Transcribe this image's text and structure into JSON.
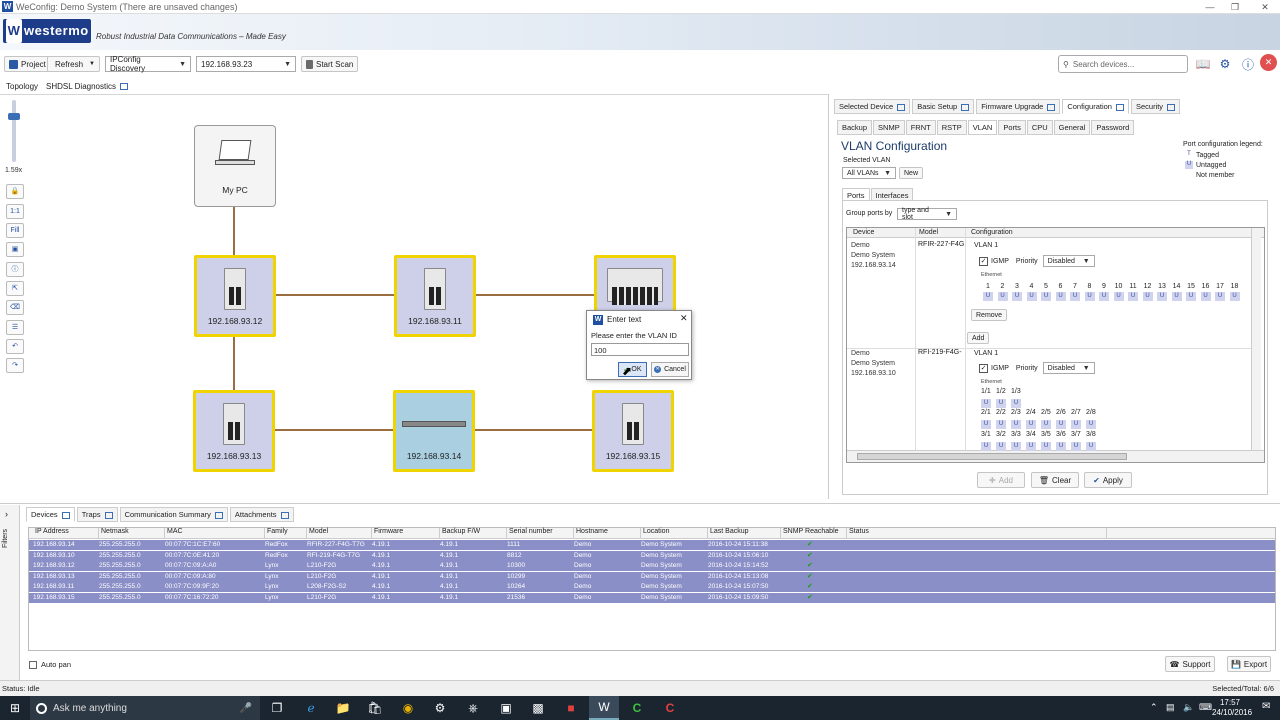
{
  "window": {
    "title": "WeConfig: Demo System (There are unsaved changes)",
    "app_icon": "W"
  },
  "banner": {
    "brand": "westermo",
    "brand_mark": "W",
    "tagline": "Robust Industrial Data Communications – Made Easy"
  },
  "toolbar": {
    "project_label": "Project",
    "refresh_label": "Refresh",
    "discovery_value": "IPConfig Discovery",
    "ip_value": "192.168.93.23",
    "start_scan_label": "Start Scan",
    "search_placeholder": "Search devices..."
  },
  "view_tabs": [
    "Topology",
    "SHDSL Diagnostics"
  ],
  "zoom_label": "1.59x",
  "left_tools": {
    "one_to_one": "1:1",
    "fill": "Fill"
  },
  "topology": {
    "pc_label": "My PC",
    "nodes": [
      {
        "ip": "192.168.93.12"
      },
      {
        "ip": "192.168.93.11"
      },
      {
        "ip": "192.168.93.13"
      },
      {
        "ip": "192.168.93.14"
      },
      {
        "ip": "192.168.93.15"
      }
    ]
  },
  "dialog": {
    "title": "Enter text",
    "prompt": "Please enter the VLAN ID",
    "value": "100",
    "ok": "OK",
    "cancel": "Cancel"
  },
  "right_panel": {
    "tabs": [
      "Selected Device",
      "Basic Setup",
      "Firmware Upgrade",
      "Configuration",
      "Security"
    ],
    "subtabs": [
      "Backup",
      "SNMP",
      "FRNT",
      "RSTP",
      "VLAN",
      "Ports",
      "CPU",
      "General",
      "Password"
    ],
    "heading": "VLAN Configuration",
    "selected_vlan_label": "Selected VLAN",
    "selected_vlan_value": "All VLANs",
    "new_button": "New",
    "legend_title": "Port configuration legend:",
    "legend": [
      {
        "mark": "T",
        "label": "Tagged"
      },
      {
        "mark": "U",
        "label": "Untagged"
      },
      {
        "mark": "",
        "label": "Not member"
      }
    ],
    "inner_tabs": [
      "Ports",
      "Interfaces"
    ],
    "group_label": "Group ports by",
    "group_value": "type and slot",
    "grid_headers": [
      "Device",
      "Model",
      "Configuration"
    ],
    "rows": [
      {
        "name": "Demo",
        "system": "Demo System",
        "ip": "192.168.93.14",
        "model": "RFIR-227-F4G",
        "vlan": "VLAN 1",
        "igmp": "IGMP",
        "priority_label": "Priority",
        "priority_value": "Disabled",
        "port_group": "Ethernet",
        "ports": [
          "1",
          "2",
          "3",
          "4",
          "5",
          "6",
          "7",
          "8",
          "9",
          "10",
          "11",
          "12",
          "13",
          "14",
          "15",
          "16",
          "17",
          "18"
        ],
        "remove": "Remove"
      },
      {
        "name": "Demo",
        "system": "Demo System",
        "ip": "192.168.93.10",
        "model": "RFI-219-F4G-",
        "vlan": "VLAN 1",
        "igmp": "IGMP",
        "priority_label": "Priority",
        "priority_value": "Disabled",
        "port_group": "Ethernet",
        "ports_row1": [
          "1/1",
          "1/2",
          "1/3"
        ],
        "ports_row2": [
          "2/1",
          "2/2",
          "2/3",
          "2/4",
          "2/5",
          "2/6",
          "2/7",
          "2/8"
        ],
        "ports_row3": [
          "3/1",
          "3/2",
          "3/3",
          "3/4",
          "3/5",
          "3/6",
          "3/7",
          "3/8"
        ]
      }
    ],
    "add_button": "Add",
    "footer": {
      "add": "Add",
      "clear": "Clear",
      "apply": "Apply"
    },
    "port_mark": "U"
  },
  "bottom_tabs": [
    "Devices",
    "Traps",
    "Communication Summary",
    "Attachments"
  ],
  "filters_label": "Filters",
  "table": {
    "headers": [
      "IP Address",
      "Netmask",
      "MAC",
      "Family",
      "Model",
      "Firmware",
      "Backup F/W",
      "Serial number",
      "Hostname",
      "Location",
      "Last Backup",
      "SNMP Reachable",
      "Status"
    ],
    "rows": [
      [
        "192.168.93.14",
        "255.255.255.0",
        "00:07:7C:1C:E7:60",
        "RedFox",
        "RFIR-227-F4G-T7G",
        "4.19.1",
        "4.19.1",
        "1111",
        "Demo",
        "Demo System",
        "2016-10-24 15:11:38"
      ],
      [
        "192.168.93.10",
        "255.255.255.0",
        "00:07:7C:0E:41:20",
        "RedFox",
        "RFI-219-F4G-T7G",
        "4.19.1",
        "4.19.1",
        "8812",
        "Demo",
        "Demo System",
        "2016-10-24 15:06:10"
      ],
      [
        "192.168.93.12",
        "255.255.255.0",
        "00:07:7C:09:A:A0",
        "Lynx",
        "L210-F2G",
        "4.19.1",
        "4.19.1",
        "10300",
        "Demo",
        "Demo System",
        "2016-10-24 15:14:52"
      ],
      [
        "192.168.93.13",
        "255.255.255.0",
        "00:07:7C:09:A:80",
        "Lynx",
        "L210-F2G",
        "4.19.1",
        "4.19.1",
        "10299",
        "Demo",
        "Demo System",
        "2016-10-24 15:13:08"
      ],
      [
        "192.168.93.11",
        "255.255.255.0",
        "00:07:7C:09:9F:20",
        "Lynx",
        "L208-F2G-S2",
        "4.19.1",
        "4.19.1",
        "10264",
        "Demo",
        "Demo System",
        "2016-10-24 15:07:50"
      ],
      [
        "192.168.93.15",
        "255.255.255.0",
        "00:07:7C:16:72:20",
        "Lynx",
        "L210-F2G",
        "4.19.1",
        "4.19.1",
        "21536",
        "Demo",
        "Demo System",
        "2016-10-24 15:09:50"
      ]
    ],
    "check_mark": "✔"
  },
  "auto_pan": "Auto pan",
  "support_button": "Support",
  "export_button": "Export",
  "statusbar": {
    "status": "Status: Idle",
    "selected": "Selected/Total: 6/6"
  },
  "taskbar": {
    "search": "Ask me anything",
    "time": "17:57",
    "date": "24/10/2016"
  }
}
